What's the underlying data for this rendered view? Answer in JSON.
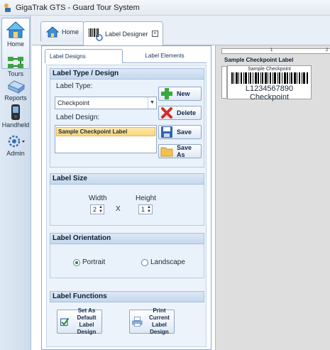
{
  "window": {
    "title": "GigaTrak GTS - Guard Tour System"
  },
  "nav": {
    "items": [
      {
        "label": "Home",
        "icon": "home-icon"
      },
      {
        "label": "Tours",
        "icon": "tours-icon"
      },
      {
        "label": "Reports",
        "icon": "reports-icon"
      },
      {
        "label": "Handheld",
        "icon": "handheld-icon"
      },
      {
        "label": "Admin",
        "icon": "admin-gear-icon"
      }
    ]
  },
  "tabs": [
    {
      "label": "Home",
      "icon": "home-icon"
    },
    {
      "label": "Label Designer",
      "icon": "barcode-icon",
      "active": true
    }
  ],
  "subtabs": [
    {
      "label": "Label Designs",
      "active": true
    },
    {
      "label": "Label Elements",
      "active": false
    }
  ],
  "type_design": {
    "header": "Label Type / Design",
    "type_label": "Label Type:",
    "type_value": "Checkpoint",
    "design_label": "Label Design:",
    "designs": [
      "Sample Checkpoint Label"
    ],
    "buttons": {
      "new": "New",
      "delete": "Delete",
      "save": "Save",
      "save_as": "Save As"
    }
  },
  "size": {
    "header": "Label Size",
    "width_label": "Width",
    "height_label": "Height",
    "width_value": "2",
    "height_value": "1",
    "separator": "X"
  },
  "orientation": {
    "header": "Label Orientation",
    "portrait": "Portrait",
    "landscape": "Landscape",
    "selected": "Portrait"
  },
  "functions": {
    "header": "Label Functions",
    "set_default_line1": "Set As Default",
    "set_default_line2": "Label Design",
    "print_line1": "Print Current",
    "print_line2": "Label Design"
  },
  "preview": {
    "ruler_mark": "1",
    "ruler_mark_2": "2",
    "title": "Sample Checkpoint Label",
    "card_name": "Sample Checkpoint",
    "card_code": "L1234567890",
    "card_type": "Checkpoint"
  },
  "colors": {
    "accent": "#1b8a2f",
    "selection": "#f9d67a",
    "section_header": "#c6d8ee",
    "panel_bg": "#edf3fa",
    "preview_bg": "#dedede"
  }
}
